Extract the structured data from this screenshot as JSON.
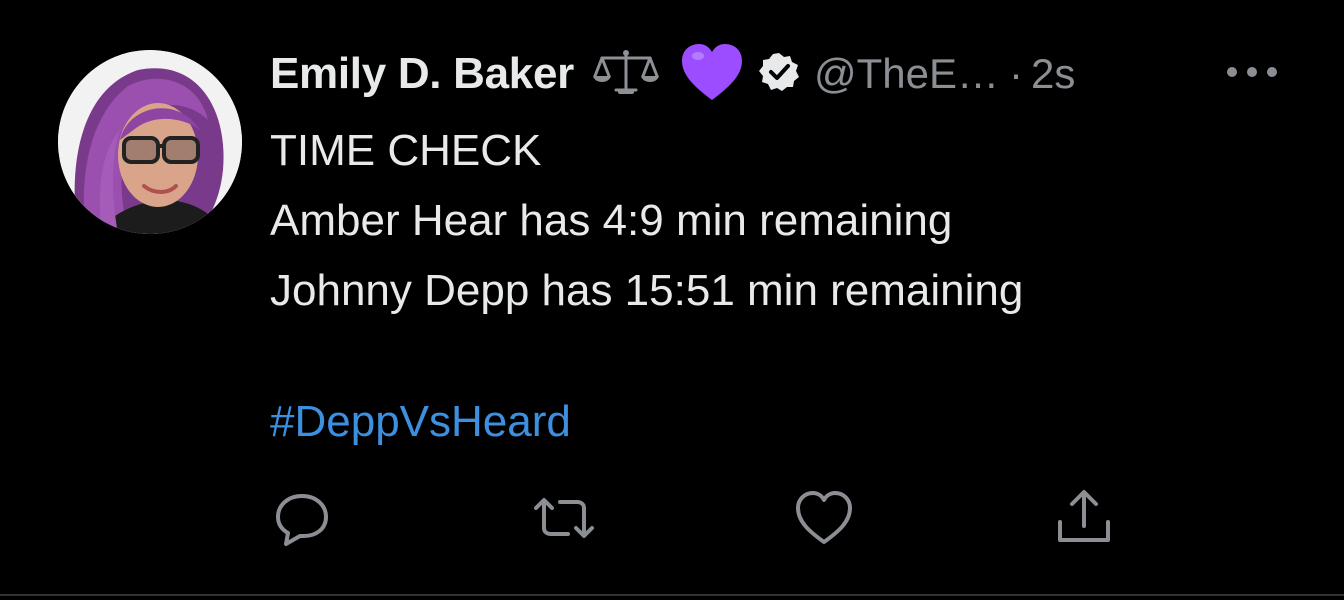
{
  "tweet": {
    "author": {
      "display_name": "Emily D. Baker",
      "handle": "@TheE…",
      "verified": true,
      "name_emojis": [
        "scales-icon",
        "purple-heart-icon"
      ]
    },
    "separator": "·",
    "time": "2s",
    "more_icon": "more-dots-icon",
    "lines": [
      "TIME CHECK",
      "Amber Hear has 4:9 min remaining",
      "Johnny Depp has 15:51 min remaining"
    ],
    "hashtag": "#DeppVsHeard",
    "actions": [
      "reply-icon",
      "retweet-icon",
      "like-icon",
      "share-icon"
    ]
  },
  "colors": {
    "background": "#000000",
    "text": "#e7e9ea",
    "secondary": "#8b8f94",
    "link": "#3d8fe0",
    "heart": "#9b4dff"
  }
}
